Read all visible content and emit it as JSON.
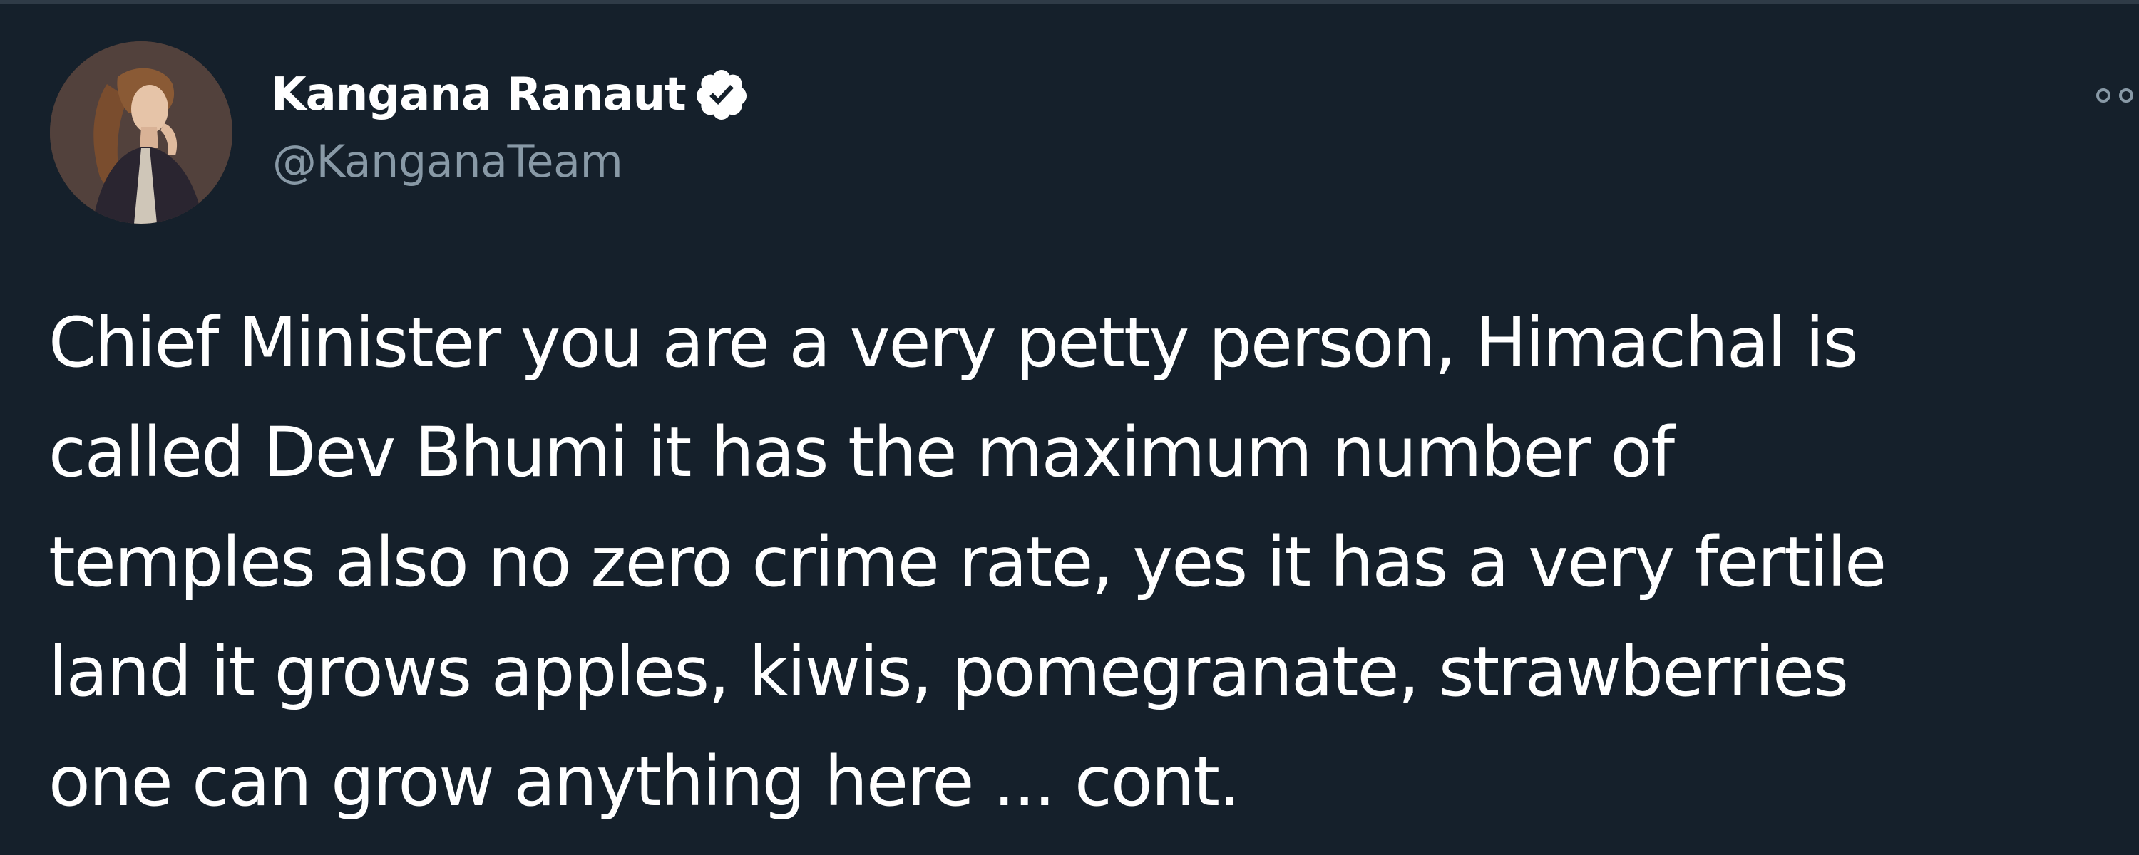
{
  "author": {
    "display_name": "Kangana Ranaut",
    "handle": "@KanganaTeam",
    "verified": true,
    "avatar_icon": "profile-photo"
  },
  "tweet": {
    "lines": [
      "Chief Minister you are a very petty person, Himachal is",
      "called Dev Bhumi it has the maximum number of",
      "temples also no zero crime rate, yes it has a very fertile",
      "land it grows apples, kiwis, pomegranate, strawberries",
      "one can grow anything here ... cont."
    ]
  },
  "icons": {
    "verified": "verified-badge-icon",
    "more": "more-options-icon"
  },
  "colors": {
    "background": "#15202b",
    "text": "#ffffff",
    "secondary_text": "#8899a6"
  }
}
